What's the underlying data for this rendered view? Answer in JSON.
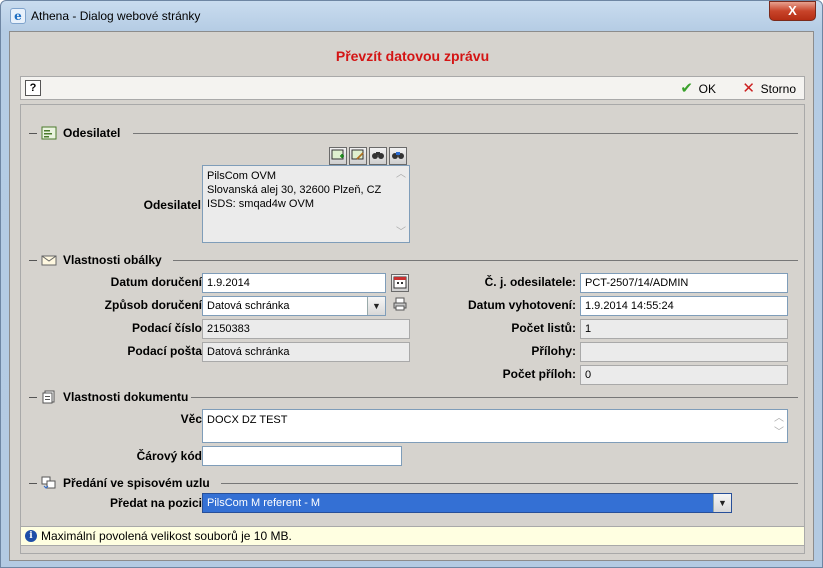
{
  "window": {
    "title": "Athena - Dialog webové stránky",
    "close_glyph": "X"
  },
  "dialog": {
    "title": "Převzít datovou zprávu"
  },
  "toolbar": {
    "help_glyph": "?",
    "ok_label": "OK",
    "storno_label": "Storno"
  },
  "sections": {
    "odesilatel": {
      "heading": "Odesilatel",
      "label": "Odesilatel:",
      "lines": [
        "PilsCom OVM",
        "Slovanská alej 30, 32600 Plzeň, CZ",
        "ISDS: smqad4w OVM"
      ]
    },
    "obalka": {
      "heading": "Vlastnosti obálky",
      "datum_doruceni": {
        "label": "Datum doručení:",
        "value": "1.9.2014"
      },
      "zpusob_doruceni": {
        "label": "Způsob doručení:",
        "value": "Datová schránka"
      },
      "podaci_cislo": {
        "label": "Podací číslo:",
        "value": "2150383"
      },
      "podaci_posta": {
        "label": "Podací pošta:",
        "value": "Datová schránka"
      },
      "cj_odesilatele": {
        "label": "Č. j. odesilatele:",
        "value": "PCT-2507/14/ADMIN"
      },
      "datum_vyhotoveni": {
        "label": "Datum vyhotovení:",
        "value": "1.9.2014 14:55:24"
      },
      "pocet_listu": {
        "label": "Počet listů:",
        "value": "1"
      },
      "prilohy": {
        "label": "Přílohy:",
        "value": ""
      },
      "pocet_priloh": {
        "label": "Počet příloh:",
        "value": "0"
      }
    },
    "dokument": {
      "heading": "Vlastnosti dokumentu",
      "vec": {
        "label": "Věc:",
        "value": "DOCX DZ TEST"
      },
      "carovy_kod": {
        "label": "Čárový kód:",
        "value": ""
      }
    },
    "predani": {
      "heading": "Předání ve spisovém uzlu",
      "predat": {
        "label": "Předat na pozici:",
        "value": "PilsCom M referent - M"
      }
    }
  },
  "info": {
    "text": "Maximální povolená velikost souborů je 10 MB.",
    "icon": "info-icon"
  },
  "colors": {
    "title_red": "#d41414",
    "selection_blue": "#3470d4",
    "info_bg": "#ffffe1"
  }
}
